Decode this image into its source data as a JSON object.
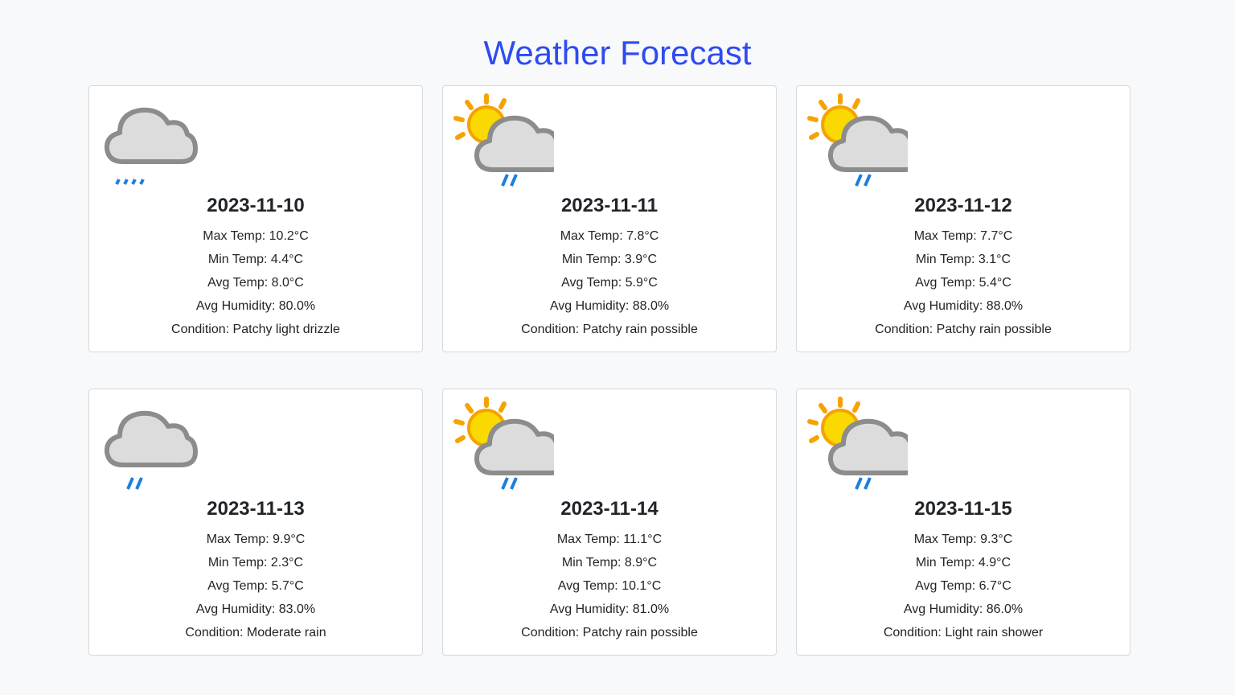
{
  "page": {
    "title": "Weather Forecast",
    "colors": {
      "title": "#2e4bf0",
      "background": "#f8f9fa",
      "card": "#ffffff"
    }
  },
  "labels": {
    "max_temp": "Max Temp:",
    "min_temp": "Min Temp:",
    "avg_temp": "Avg Temp:",
    "avg_humidity": "Avg Humidity:",
    "condition": "Condition:"
  },
  "forecast": [
    {
      "date": "2023-11-10",
      "icon": "cloud-drizzle-icon",
      "max_temp": "10.2°C",
      "min_temp": "4.4°C",
      "avg_temp": "8.0°C",
      "avg_humidity": "80.0%",
      "condition": "Patchy light drizzle"
    },
    {
      "date": "2023-11-11",
      "icon": "sun-cloud-rain-icon",
      "max_temp": "7.8°C",
      "min_temp": "3.9°C",
      "avg_temp": "5.9°C",
      "avg_humidity": "88.0%",
      "condition": "Patchy rain possible"
    },
    {
      "date": "2023-11-12",
      "icon": "sun-cloud-rain-icon",
      "max_temp": "7.7°C",
      "min_temp": "3.1°C",
      "avg_temp": "5.4°C",
      "avg_humidity": "88.0%",
      "condition": "Patchy rain possible"
    },
    {
      "date": "2023-11-13",
      "icon": "cloud-rain-icon",
      "max_temp": "9.9°C",
      "min_temp": "2.3°C",
      "avg_temp": "5.7°C",
      "avg_humidity": "83.0%",
      "condition": "Moderate rain"
    },
    {
      "date": "2023-11-14",
      "icon": "sun-cloud-rain-icon",
      "max_temp": "11.1°C",
      "min_temp": "8.9°C",
      "avg_temp": "10.1°C",
      "avg_humidity": "81.0%",
      "condition": "Patchy rain possible"
    },
    {
      "date": "2023-11-15",
      "icon": "sun-cloud-rain-icon",
      "max_temp": "9.3°C",
      "min_temp": "4.9°C",
      "avg_temp": "6.7°C",
      "avg_humidity": "86.0%",
      "condition": "Light rain shower"
    }
  ]
}
